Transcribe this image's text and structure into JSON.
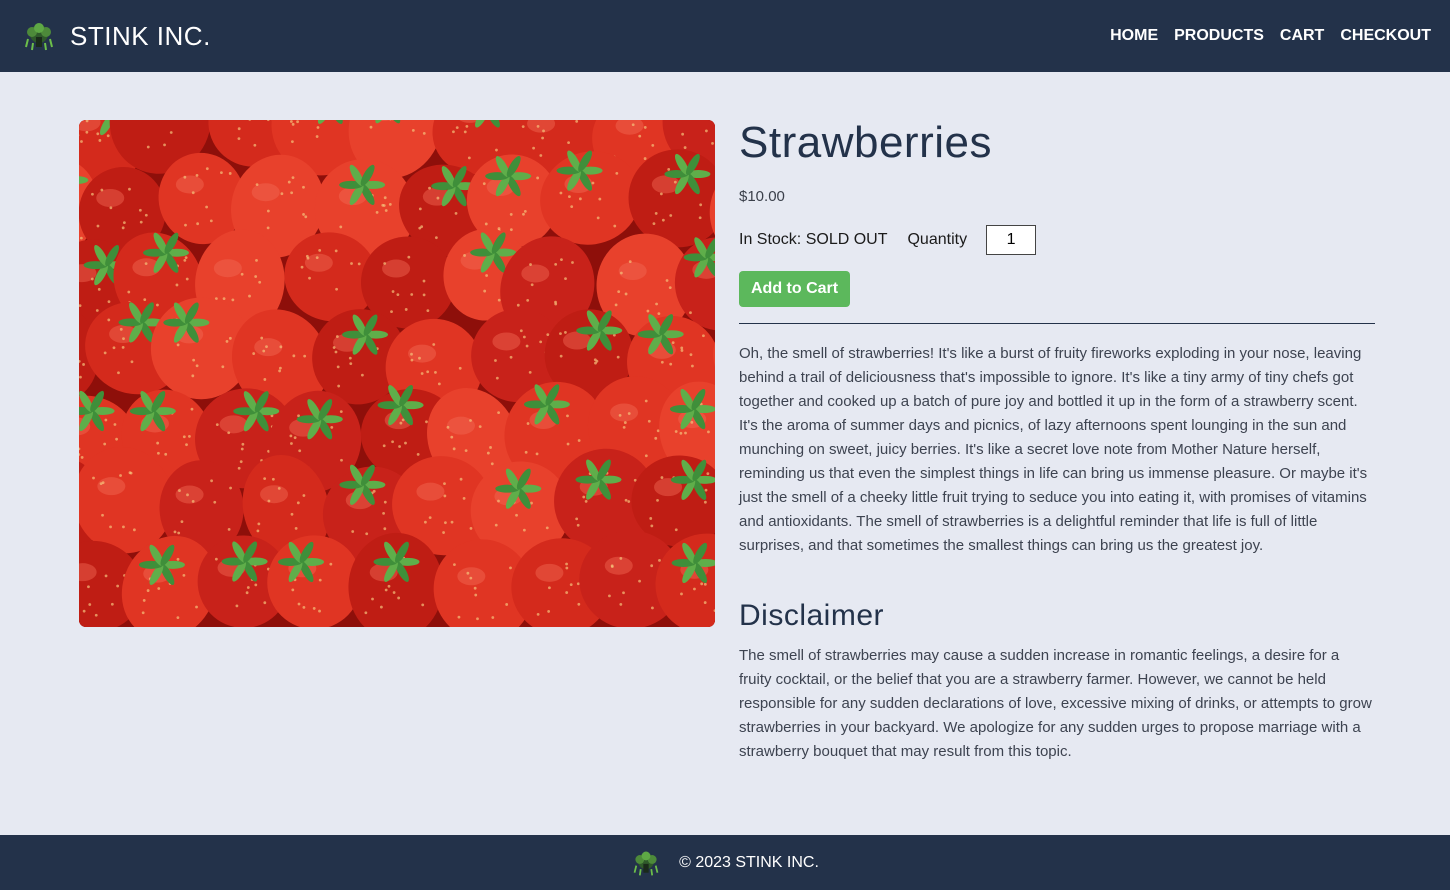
{
  "brand": {
    "name": "STINK INC.",
    "logo_icon": "stink-cloud-logo-icon"
  },
  "nav": {
    "items": [
      {
        "label": "HOME"
      },
      {
        "label": "PRODUCTS"
      },
      {
        "label": "CART"
      },
      {
        "label": "CHECKOUT"
      }
    ]
  },
  "product": {
    "title": "Strawberries",
    "price": "$10.00",
    "stock": "In Stock: SOLD OUT",
    "quantity_label": "Quantity",
    "quantity_value": "1",
    "add_to_cart_label": "Add to Cart",
    "image_icon": "strawberries-photo",
    "description": "Oh, the smell of strawberries! It's like a burst of fruity fireworks exploding in your nose, leaving behind a trail of deliciousness that's impossible to ignore. It's like a tiny army of tiny chefs got together and cooked up a batch of pure joy and bottled it up in the form of a strawberry scent. It's the aroma of summer days and picnics, of lazy afternoons spent lounging in the sun and munching on sweet, juicy berries. It's like a secret love note from Mother Nature herself, reminding us that even the simplest things in life can bring us immense pleasure. Or maybe it's just the smell of a cheeky little fruit trying to seduce you into eating it, with promises of vitamins and antioxidants. The smell of strawberries is a delightful reminder that life is full of little surprises, and that sometimes the smallest things can bring us the greatest joy.",
    "disclaimer_title": "Disclaimer",
    "disclaimer_text": "The smell of strawberries may cause a sudden increase in romantic feelings, a desire for a fruity cocktail, or the belief that you are a strawberry farmer. However, we cannot be held responsible for any sudden declarations of love, excessive mixing of drinks, or attempts to grow strawberries in your backyard. We apologize for any sudden urges to propose marriage with a strawberry bouquet that may result from this topic."
  },
  "footer": {
    "text": "© 2023 STINK INC."
  },
  "colors": {
    "navbar": "#23324a",
    "background": "#e6e9f2",
    "button": "#5cb85c"
  }
}
